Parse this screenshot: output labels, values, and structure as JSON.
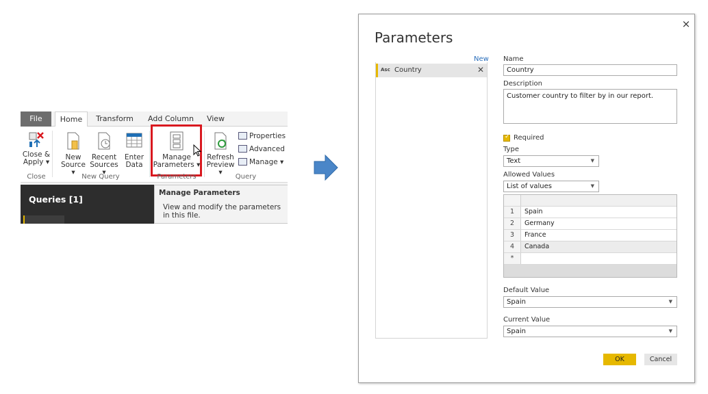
{
  "ribbon": {
    "tabs": [
      "File",
      "Home",
      "Transform",
      "Add Column",
      "View"
    ],
    "buttons": {
      "close_apply": [
        "Close &",
        "Apply ▾"
      ],
      "new_source": [
        "New",
        "Source ▾"
      ],
      "recent_sources": [
        "Recent",
        "Sources ▾"
      ],
      "enter_data": [
        "Enter",
        "Data"
      ],
      "manage_parameters": [
        "Manage",
        "Parameters ▾"
      ],
      "refresh_preview": [
        "Refresh",
        "Preview ▾"
      ],
      "properties": "Properties",
      "advanced_editor": "Advanced E",
      "manage": "Manage ▾"
    },
    "groups": [
      "Close",
      "New Query",
      "Parameters",
      "Query"
    ],
    "highlight_color": "#d9181f"
  },
  "queries_pane": {
    "title": "Queries [1]"
  },
  "tooltip": {
    "title": "Manage Parameters",
    "text": "View and modify the parameters in this file."
  },
  "dialog": {
    "title": "Parameters",
    "close_glyph": "×",
    "new_link": "New",
    "parameters": [
      {
        "type_badge": "Asc",
        "name": "Country",
        "delete_glyph": "✕"
      }
    ],
    "fields": {
      "name_label": "Name",
      "name_value": "Country",
      "description_label": "Description",
      "description_value": "Customer country to filter by in our report.",
      "required_label": "Required",
      "required_checked": true,
      "type_label": "Type",
      "type_value": "Text",
      "allowed_values_label": "Allowed Values",
      "allowed_values_value": "List of values",
      "allowed_list": [
        {
          "n": "1",
          "v": "Spain"
        },
        {
          "n": "2",
          "v": "Germany"
        },
        {
          "n": "3",
          "v": "France"
        },
        {
          "n": "4",
          "v": "Canada"
        },
        {
          "n": "*",
          "v": ""
        }
      ],
      "default_value_label": "Default Value",
      "default_value": "Spain",
      "current_value_label": "Current Value",
      "current_value": "Spain"
    },
    "ok_label": "OK",
    "cancel_label": "Cancel",
    "accent_color": "#e6b800"
  },
  "arrow_color": "#4a86c8"
}
